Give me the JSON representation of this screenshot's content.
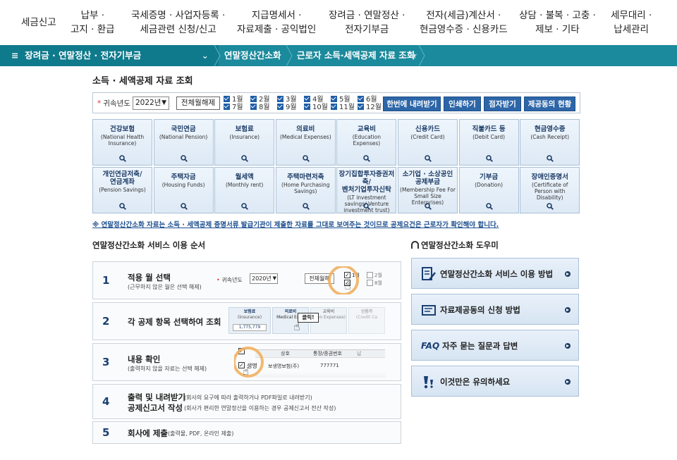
{
  "topnav": [
    {
      "label": "세금신고"
    },
    {
      "label": "납부 ·\n고지 · 환급"
    },
    {
      "label": "국세증명 · 사업자등록 ·\n세금관련 신청/신고"
    },
    {
      "label": "지급명세서 ·\n자료제출 · 공익법인"
    },
    {
      "label": "장려금 · 연말정산 ·\n전자기부금"
    },
    {
      "label": "전자(세금)계산서 ·\n현금영수증 · 신용카드"
    },
    {
      "label": "상담 · 불복 · 고충 ·\n제보 · 기타"
    },
    {
      "label": "세무대리 ·\n납세관리"
    }
  ],
  "breadcrumb": {
    "menu_icon": "≡",
    "main": "장려금 · 연말정산 · 전자기부금",
    "chev": "⌄",
    "item1": "연말정산간소화",
    "item2": "근로자 소득·세액공제 자료 조회",
    "star": "★"
  },
  "section_title": "소득 · 세액공제 자료 조회",
  "filter": {
    "required_mark": "*",
    "year_label": "귀속년도",
    "year_value": "2022년",
    "clear_all": "전체월해제",
    "months": [
      "1월",
      "2월",
      "3월",
      "4월",
      "5월",
      "6월",
      "7월",
      "8월",
      "9월",
      "10월",
      "11월",
      "12월"
    ],
    "download_all": "한번에 내려받기",
    "print": "인쇄하기",
    "braille": "점자받기",
    "provider_status": "제공동의 현황"
  },
  "categories": [
    {
      "ko": "건강보험",
      "en": "(National Health Insurance)"
    },
    {
      "ko": "국민연금",
      "en": "(National Pension)"
    },
    {
      "ko": "보험료",
      "en": "(Insurance)"
    },
    {
      "ko": "의료비",
      "en": "(Medical Expenses)"
    },
    {
      "ko": "교육비",
      "en": "(Education Expenses)"
    },
    {
      "ko": "신용카드",
      "en": "(Credit Card)"
    },
    {
      "ko": "직불카드 등",
      "en": "(Debit Card)"
    },
    {
      "ko": "현금영수증",
      "en": "(Cash Receipt)"
    },
    {
      "ko": "개인연금저축/\n연금계좌",
      "en": "(Pension Savings)"
    },
    {
      "ko": "주택자금",
      "en": "(Housing Funds)"
    },
    {
      "ko": "월세액",
      "en": "(Monthly rent)"
    },
    {
      "ko": "주택마련저축",
      "en": "(Home Purchasing Savings)"
    },
    {
      "ko": "장기집합투자증권저축/\n벤처기업투자신탁",
      "en": "(LT investment savings/ Venture investment trust)"
    },
    {
      "ko": "소기업 · 소상공인\n공제부금",
      "en": "(Membership Fee For Small Size Enterprises)"
    },
    {
      "ko": "기부금",
      "en": "(Donation)"
    },
    {
      "ko": "장애인증명서",
      "en": "(Certificate of Person with Disability)"
    }
  ],
  "notice": "※ 연말정산간소화 자료는 소득 · 세액공제 증명서류 발급기관이 제출한 자료를 그대로 보여주는 것이므로 공제요건은 근로자가 확인해야 합니다.",
  "steps_title": "연말정산간소화 서비스 이용 순서",
  "steps": [
    {
      "num": "1",
      "title": "적용 월 선택",
      "desc": "(근무하지 않은 월은 선택 해제)"
    },
    {
      "num": "2",
      "title": "각 공제 항목 선택하여 조회",
      "desc": ""
    },
    {
      "num": "3",
      "title": "내용 확인",
      "desc": "(출력하지 않을 자료는 선택 해제)"
    },
    {
      "num": "4",
      "title": "출력 및 내려받기",
      "title2": "공제신고서 작성",
      "desc": "(회사의 요구에 따라 출력하거나 PDF파일로 내려받기)",
      "desc2": "(회사가 편리한 연말정산을 이용하는 경우 공제신고서 전산 작성)"
    },
    {
      "num": "5",
      "title": "회사에 제출",
      "desc": "(출력물, PDF, 온라인 제출)"
    }
  ],
  "step_art": {
    "s1_label": "귀속년도",
    "s1_year": "2020년",
    "s1_clear": "전체월해",
    "s1_m1": "1월",
    "s1_m2": "2월",
    "s1_m3": "8월",
    "s2_c1_ko": "보험료",
    "s2_c1_en": "(Insurance)",
    "s2_c1_val": "1,775,779",
    "s2_c2_ko": "의료비",
    "s2_c2_en": "Medical Expe",
    "s2_click": "클릭!",
    "s2_c3_ko": "교육비",
    "s2_c3_en": "ation Expenses)",
    "s2_c4_ko": "신용카",
    "s2_c4_en": "(Credit Ca",
    "s3_h1": "상호",
    "s3_h2": "통장/증권번호",
    "s3_h3": "납",
    "s3_r1_a": "생명",
    "s3_r1_b": "보생명보험(주)",
    "s3_r1_c": "777771"
  },
  "help_title": "연말정산간소화 도우미",
  "help_items": [
    {
      "label": "연말정산간소화 서비스 이용 방법"
    },
    {
      "label": "자료제공동의 신청 방법"
    },
    {
      "prefix": "FAQ",
      "label": "자주 묻는 질문과 답변"
    },
    {
      "label": "이것만은 유의하세요"
    }
  ],
  "colors": {
    "accent": "#1b8a9c",
    "button": "#2d66a8",
    "navy": "#1a3f73"
  }
}
